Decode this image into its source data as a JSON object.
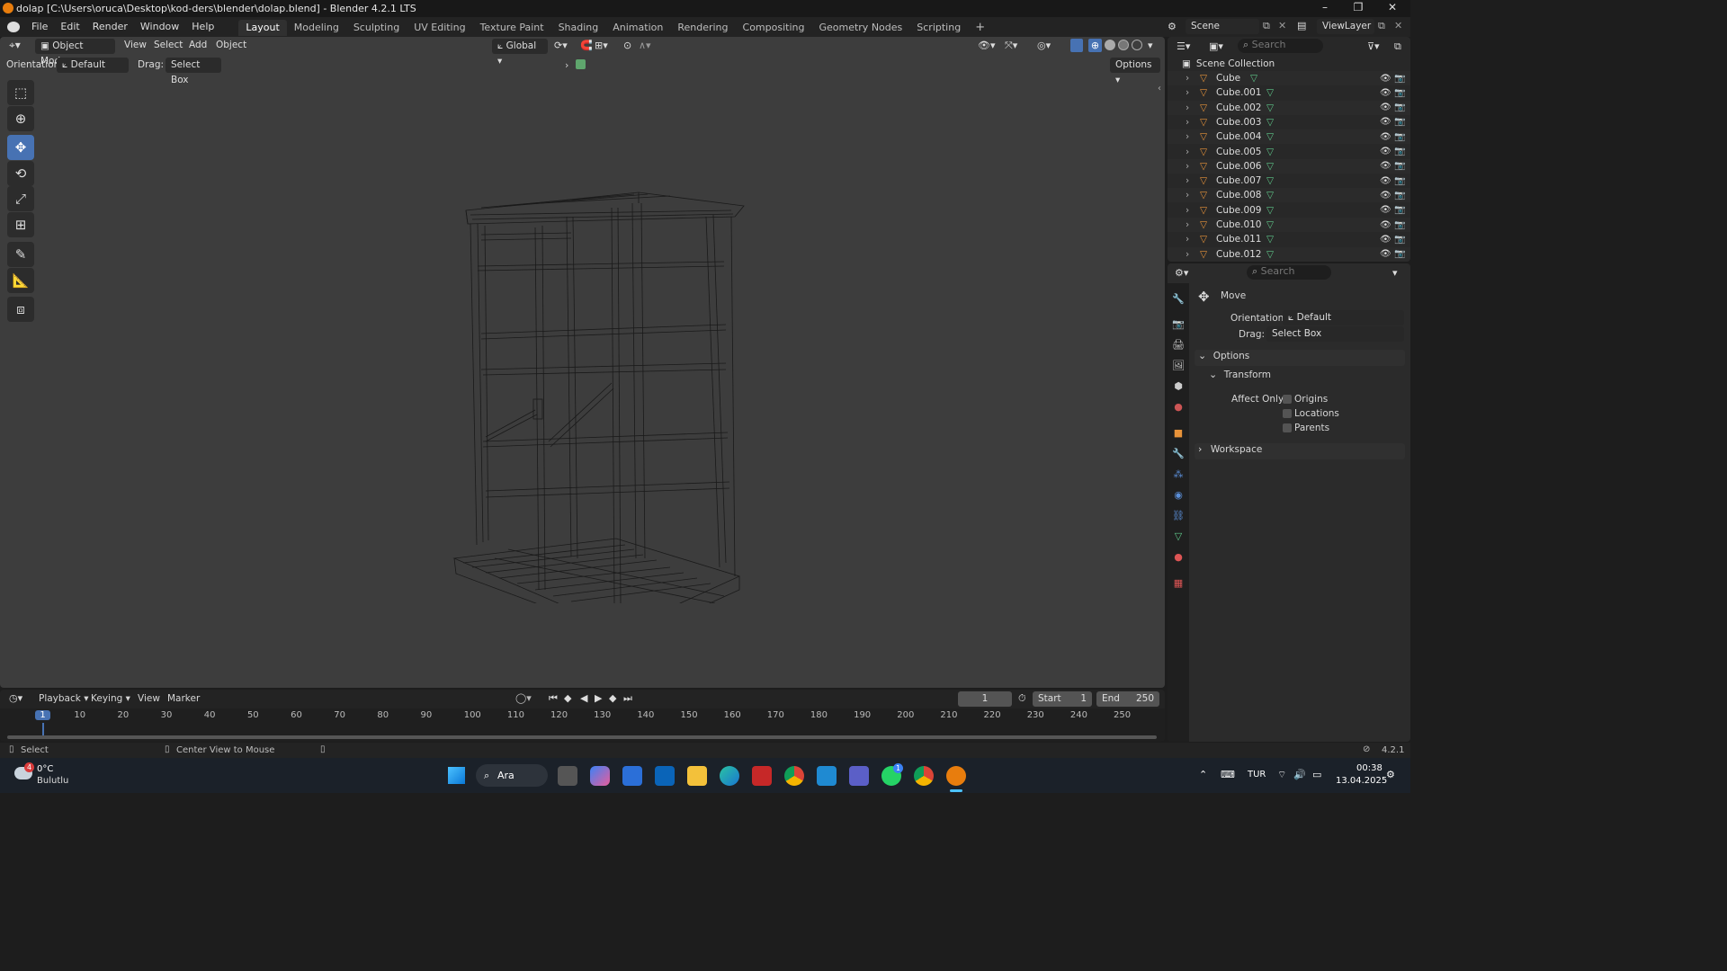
{
  "window": {
    "title": "dolap [C:\\Users\\oruca\\Desktop\\kod-ders\\blender\\dolap.blend] - Blender 4.2.1 LTS",
    "minimize": "–",
    "maximize": "❐",
    "close": "✕"
  },
  "menu": {
    "items": [
      "File",
      "Edit",
      "Render",
      "Window",
      "Help"
    ],
    "workspace_tabs": [
      "Layout",
      "Modeling",
      "Sculpting",
      "UV Editing",
      "Texture Paint",
      "Shading",
      "Animation",
      "Rendering",
      "Compositing",
      "Geometry Nodes",
      "Scripting"
    ],
    "active_tab": "Layout",
    "add_tab": "+",
    "scene_label": "Scene",
    "view_layer_label": "ViewLayer"
  },
  "viewport": {
    "mode": "Object Mode",
    "menus": [
      "View",
      "Select",
      "Add",
      "Object"
    ],
    "transform_orientation": "Global",
    "orientation_label": "Orientation:",
    "orientation_value": "Default",
    "drag_label": "Drag:",
    "drag_value": "Select Box",
    "options_label": "Options"
  },
  "outliner": {
    "search_placeholder": "Search",
    "collection_name": "Scene Collection",
    "objects": [
      "Cube",
      "Cube.001",
      "Cube.002",
      "Cube.003",
      "Cube.004",
      "Cube.005",
      "Cube.006",
      "Cube.007",
      "Cube.008",
      "Cube.009",
      "Cube.010",
      "Cube.011",
      "Cube.012"
    ]
  },
  "properties": {
    "search_placeholder": "Search",
    "tool_name": "Move",
    "orientation_label": "Orientation",
    "orientation_value": "Default",
    "drag_label": "Drag:",
    "drag_value": "Select Box",
    "options_panel": "Options",
    "transform_panel": "Transform",
    "affect_only_label": "Affect Only",
    "checkbox_origins": "Origins",
    "checkbox_locations": "Locations",
    "checkbox_parents": "Parents",
    "workspace_panel": "Workspace"
  },
  "timeline": {
    "menus": [
      "Playback",
      "Keying",
      "View",
      "Marker"
    ],
    "current_frame": "1",
    "start_label": "Start",
    "start_value": "1",
    "end_label": "End",
    "end_value": "250",
    "ticks": [
      "1",
      "10",
      "20",
      "30",
      "40",
      "50",
      "60",
      "70",
      "80",
      "90",
      "100",
      "110",
      "120",
      "130",
      "140",
      "150",
      "160",
      "170",
      "180",
      "190",
      "200",
      "210",
      "220",
      "230",
      "240",
      "250"
    ]
  },
  "statusbar": {
    "select_hint": "Select",
    "center_hint": "Center View to Mouse",
    "version": "4.2.1"
  },
  "taskbar": {
    "weather_temp": "0°C",
    "weather_desc": "Bulutlu",
    "weather_badge": "4",
    "search_label": "Ara",
    "language": "TUR",
    "time": "00:38",
    "date": "13.04.2025",
    "whatsapp_badge": "1"
  },
  "colors": {
    "accent": "#4772b3",
    "viewport_bg": "#3d3d3d",
    "object_orange": "#e8933a",
    "mesh_green": "#5fc98a"
  }
}
